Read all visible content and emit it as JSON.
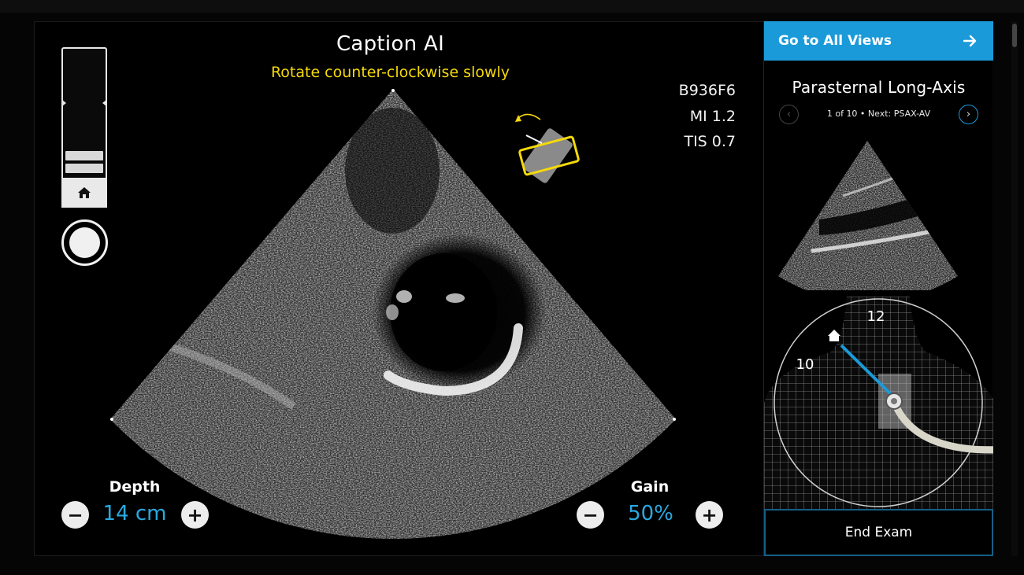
{
  "app": {
    "title": "Caption AI",
    "guidance": "Rotate counter-clockwise slowly"
  },
  "specs": {
    "id": "B936F6",
    "mi": "MI 1.2",
    "tis": "TIS 0.7"
  },
  "depth": {
    "label": "Depth",
    "value": "14 cm",
    "minus": "−",
    "plus": "+"
  },
  "gain": {
    "label": "Gain",
    "value": "50%",
    "minus": "−",
    "plus": "+"
  },
  "panel": {
    "goto_label": "Go to All Views",
    "goto_icon": "arrow-right-icon",
    "view_title": "Parasternal Long-Axis",
    "nav_text": "1 of 10 • Next: PSAX-AV",
    "prev_icon": "‹",
    "next_icon": "›",
    "clock_12": "12",
    "clock_10": "10",
    "end_exam_label": "End Exam"
  },
  "colors": {
    "accent": "#1a9ad9",
    "value_blue": "#29a9e1",
    "guidance_yellow": "#f5d90a"
  }
}
